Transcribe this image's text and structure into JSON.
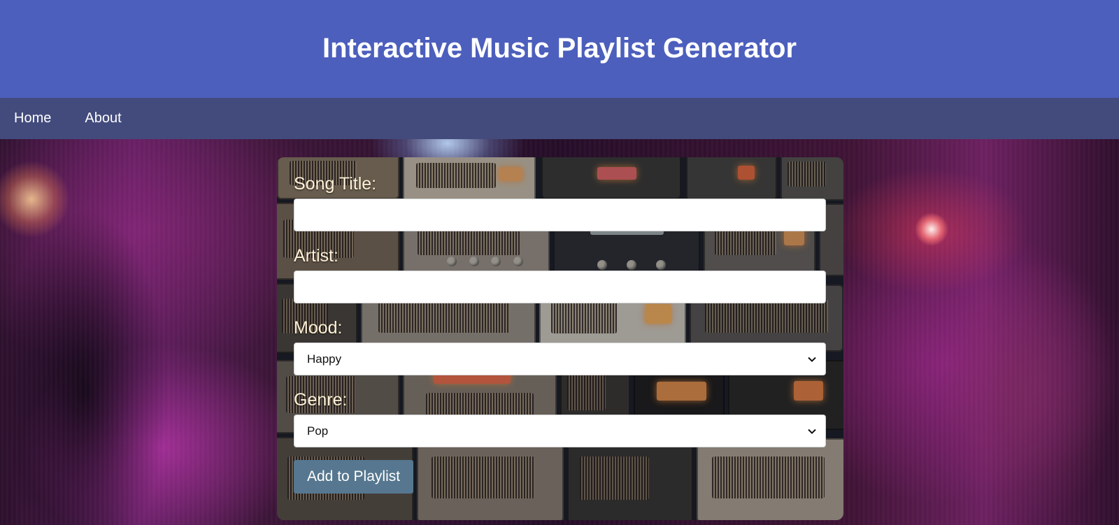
{
  "header": {
    "title": "Interactive Music Playlist Generator"
  },
  "nav": {
    "items": [
      {
        "label": "Home"
      },
      {
        "label": "About"
      }
    ]
  },
  "form": {
    "song_title": {
      "label": "Song Title:",
      "value": "",
      "placeholder": ""
    },
    "artist": {
      "label": "Artist:",
      "value": "",
      "placeholder": ""
    },
    "mood": {
      "label": "Mood:",
      "selected": "Happy"
    },
    "genre": {
      "label": "Genre:",
      "selected": "Pop"
    },
    "submit_label": "Add to Playlist"
  },
  "colors": {
    "header_bg": "#4c5fbd",
    "nav_bg": "#434b7d",
    "button_bg": "#56778f",
    "label_text": "#fff1d6"
  },
  "icons": {
    "select_arrow": "chevron-down-icon"
  }
}
